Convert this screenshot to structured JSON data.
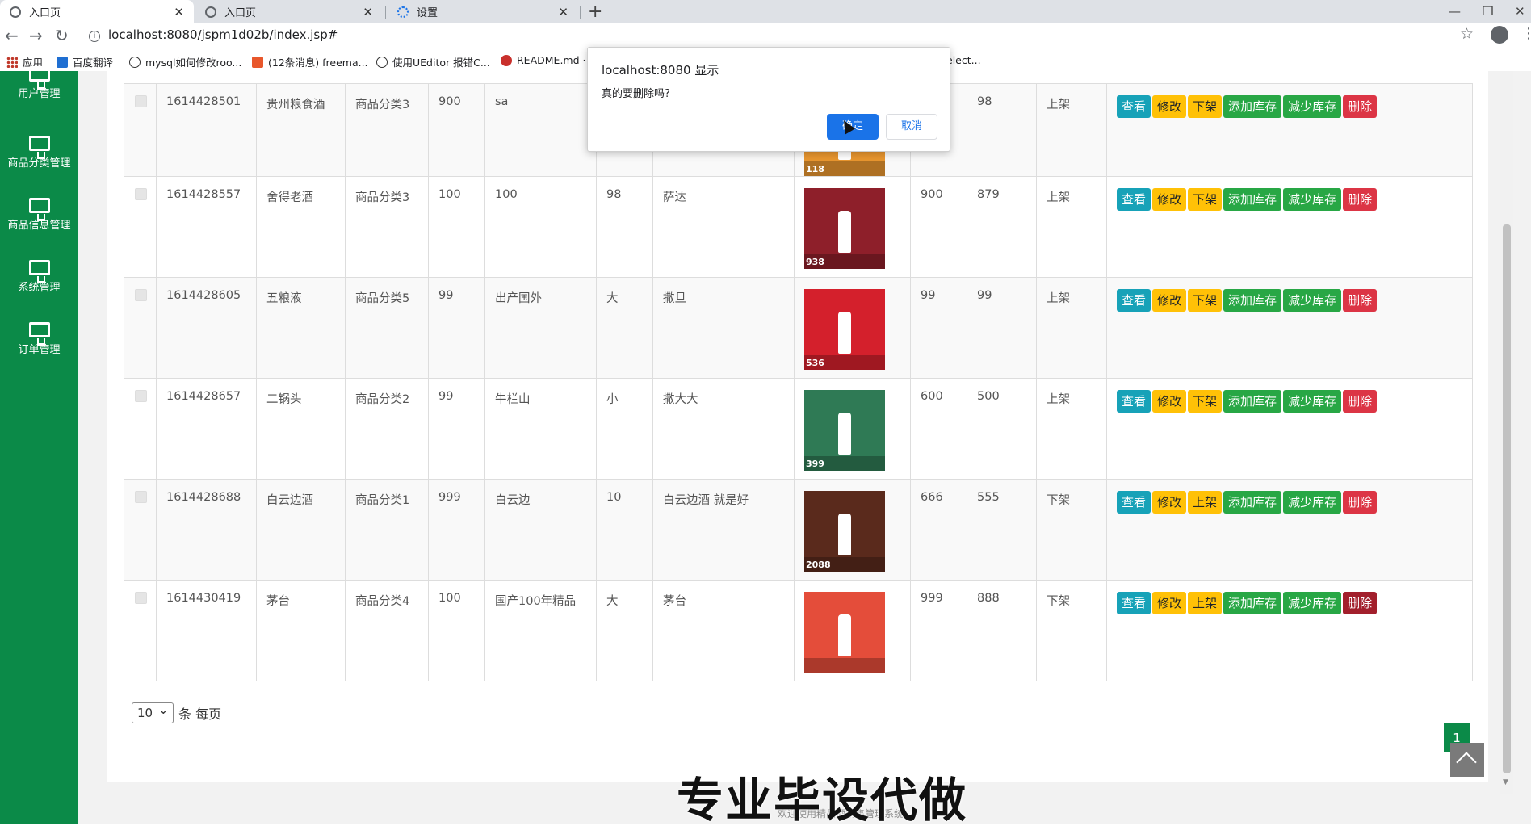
{
  "browser": {
    "tabs": [
      {
        "label": "入口页",
        "active": true
      },
      {
        "label": "入口页",
        "active": false
      },
      {
        "label": "设置",
        "active": false
      }
    ],
    "url": "localhost:8080/jspm1d02b/index.jsp#",
    "bookmarks": [
      "应用",
      "百度翻译",
      "mysql如何修改roo...",
      "(12条消息) freema...",
      "使用UEditor 报错C...",
      "README.md ·",
      "elect..."
    ]
  },
  "sidebar": {
    "items": [
      "用户管理",
      "商品分类管理",
      "商品信息管理",
      "系统管理",
      "订单管理"
    ]
  },
  "buttons": {
    "view": "查看",
    "edit": "修改",
    "add_stock": "添加库存",
    "sub_stock": "减少库存",
    "delete": "删除"
  },
  "table": {
    "rows": [
      {
        "id": "1614428501",
        "name": "贵州粮食酒",
        "category": "商品分类3",
        "price": "900",
        "origin": "sa",
        "spec": "",
        "desc": "",
        "original_price": "",
        "stock": "98",
        "status": "上架",
        "shelf_action": "下架",
        "img_color": "#e8962f",
        "img_price": "118"
      },
      {
        "id": "1614428557",
        "name": "舍得老酒",
        "category": "商品分类3",
        "price": "100",
        "origin": "100",
        "spec": "98",
        "desc": "萨达",
        "original_price": "900",
        "stock": "879",
        "status": "上架",
        "shelf_action": "下架",
        "img_color": "#8e1f2a",
        "img_price": "938"
      },
      {
        "id": "1614428605",
        "name": "五粮液",
        "category": "商品分类5",
        "price": "99",
        "origin": "出产国外",
        "spec": "大",
        "desc": "撒旦",
        "original_price": "99",
        "stock": "99",
        "status": "上架",
        "shelf_action": "下架",
        "img_color": "#d4202c",
        "img_price": "536"
      },
      {
        "id": "1614428657",
        "name": "二锅头",
        "category": "商品分类2",
        "price": "99",
        "origin": "牛栏山",
        "spec": "小",
        "desc": "撒大大",
        "original_price": "600",
        "stock": "500",
        "status": "上架",
        "shelf_action": "下架",
        "img_color": "#2f7a55",
        "img_price": "399"
      },
      {
        "id": "1614428688",
        "name": "白云边酒",
        "category": "商品分类1",
        "price": "999",
        "origin": "白云边",
        "spec": "10",
        "desc": "白云边酒 就是好",
        "original_price": "666",
        "stock": "555",
        "status": "下架",
        "shelf_action": "上架",
        "img_color": "#5a2a1c",
        "img_price": "2088"
      },
      {
        "id": "1614430419",
        "name": "茅台",
        "category": "商品分类4",
        "price": "100",
        "origin": "国产100年精品",
        "spec": "大",
        "desc": "茅台",
        "original_price": "999",
        "stock": "888",
        "status": "下架",
        "shelf_action": "上架",
        "img_color": "#e44d3a",
        "img_price": ""
      }
    ]
  },
  "pagination": {
    "page_size": "10",
    "page_size_label": "条 每页",
    "current_page": "1"
  },
  "dialog": {
    "title": "localhost:8080 显示",
    "message": "真的要删除吗?",
    "ok_label": "确定",
    "cancel_label": "取消"
  },
  "overlay": {
    "watermark": "专业毕设代做",
    "footer": "欢迎使用精品酒销售管理系统"
  }
}
